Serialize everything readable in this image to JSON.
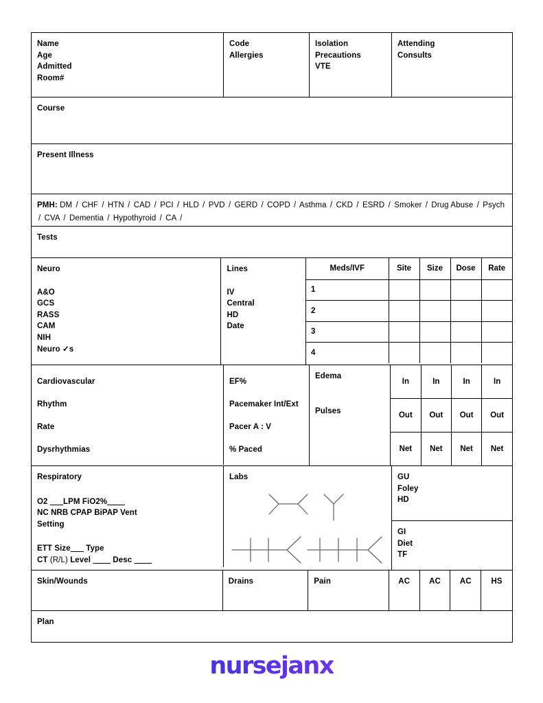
{
  "header": {
    "patient": [
      "Name",
      "Age",
      "Admitted",
      "Room#"
    ],
    "code": [
      "Code",
      "Allergies"
    ],
    "isolation": [
      "Isolation",
      "Precautions",
      "VTE"
    ],
    "attending": [
      "Attending",
      "Consults"
    ]
  },
  "course": {
    "label": "Course"
  },
  "present_illness": {
    "label": "Present Illness"
  },
  "pmh": {
    "label": "PMH:",
    "items": [
      "DM",
      "CHF",
      "HTN",
      "CAD",
      "PCI",
      "HLD",
      "PVD",
      "GERD",
      "COPD",
      "Asthma",
      "CKD",
      "ESRD",
      "Smoker",
      "Drug Abuse",
      "Psych",
      "CVA",
      "Dementia",
      "Hypothyroid",
      "CA"
    ],
    "separator": "/"
  },
  "tests": {
    "label": "Tests"
  },
  "neuro": {
    "label": "Neuro",
    "items": [
      "A&O",
      "GCS",
      "RASS",
      "CAM",
      "NIH",
      "Neuro ✓s"
    ]
  },
  "lines": {
    "label": "Lines",
    "items": [
      "IV",
      "Central",
      "HD",
      "Date"
    ]
  },
  "meds": {
    "headers": [
      "Meds/IVF",
      "Site",
      "Size",
      "Dose",
      "Rate"
    ],
    "rows": [
      "1",
      "2",
      "3",
      "4"
    ]
  },
  "cardiovascular": {
    "label": "Cardiovascular",
    "items": [
      "Rhythm",
      "Rate",
      "Dysrhythmias"
    ]
  },
  "ef": {
    "label": "EF%",
    "items": [
      "Pacemaker Int/Ext",
      "Pacer  A : V",
      "% Paced"
    ]
  },
  "edema": {
    "label": "Edema",
    "pulses_label": "Pulses"
  },
  "io_grid": {
    "rows": [
      [
        "In",
        "In",
        "In",
        "In"
      ],
      [
        "Out",
        "Out",
        "Out",
        "Out"
      ],
      [
        "Net",
        "Net",
        "Net",
        "Net"
      ]
    ]
  },
  "respiratory": {
    "label": "Respiratory",
    "o2_prefix": "O2",
    "o2_blank": "___",
    "o2_unit": "LPM",
    "fio2_label": "FiO2%",
    "fio2_blank": "____",
    "devices": "NC  NRB  CPAP  BiPAP  Vent",
    "setting": "Setting",
    "ett_label": "ETT Size",
    "ett_blank": "___",
    "ett_type": "Type",
    "ct_label": "CT",
    "ct_side": "(R/L)",
    "ct_level_label": "Level",
    "ct_level_blank": "____",
    "ct_desc_label": "Desc",
    "ct_desc_blank": "____"
  },
  "labs": {
    "label": "Labs"
  },
  "gu": {
    "label": "GU",
    "items": [
      "Foley",
      "HD"
    ]
  },
  "gi": {
    "label": "GI",
    "items": [
      "Diet",
      "TF"
    ]
  },
  "skin": {
    "label": "Skin/Wounds"
  },
  "drains": {
    "label": "Drains"
  },
  "pain": {
    "label": "Pain"
  },
  "glucose": {
    "cells": [
      "AC",
      "AC",
      "AC",
      "HS"
    ]
  },
  "plan": {
    "label": "Plan"
  },
  "branding": {
    "wordmark": "nursejanx"
  },
  "colors": {
    "border": "#000000",
    "page": "#ffffff",
    "logo_start": "#4733dd",
    "logo_end": "#6a33f0"
  }
}
